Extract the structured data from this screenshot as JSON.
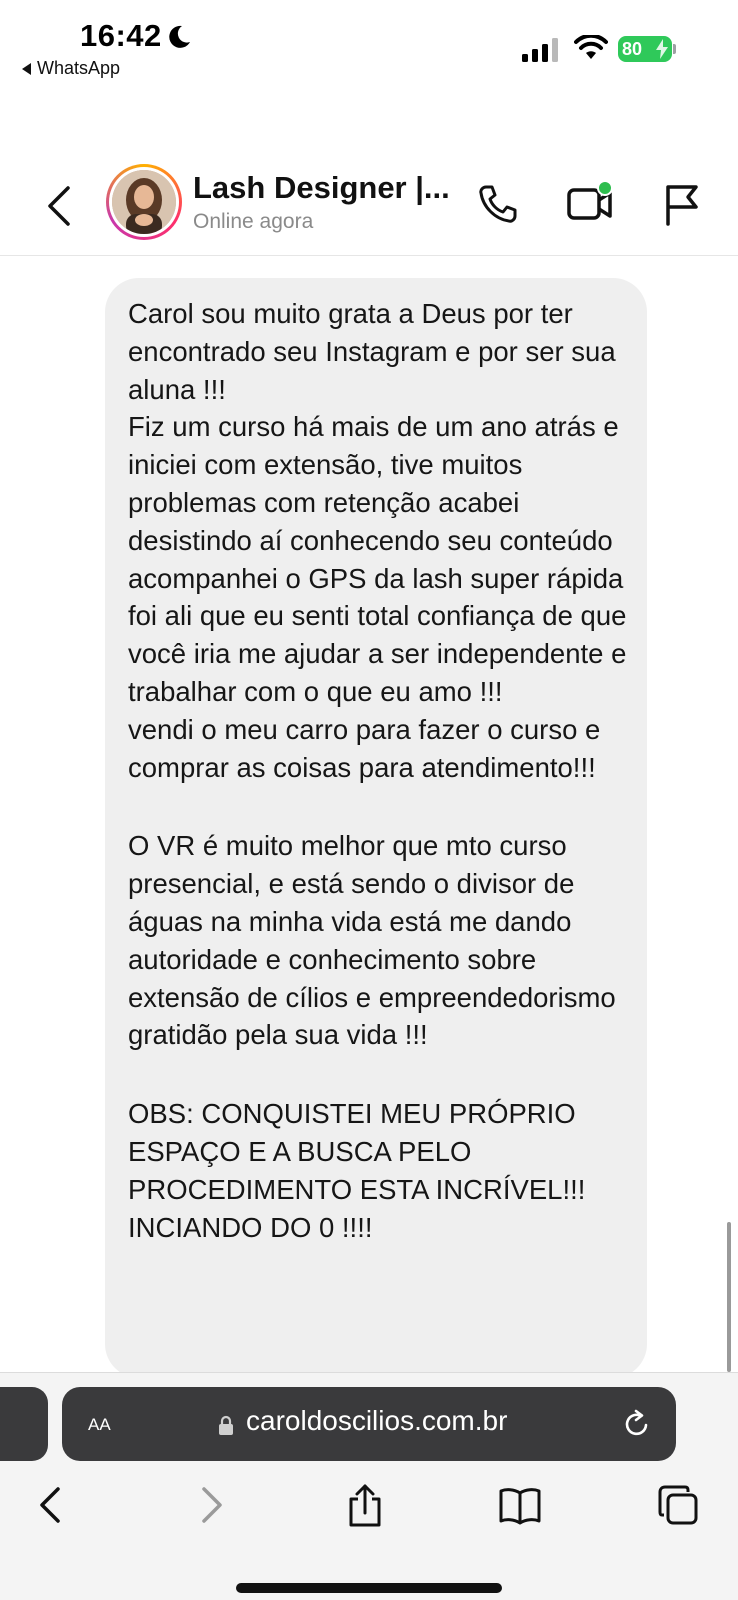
{
  "status_bar": {
    "time": "16:42",
    "back_app": "WhatsApp",
    "battery": "80"
  },
  "chat_header": {
    "contact_name": "Lash Designer |...",
    "status": "Online agora"
  },
  "message": {
    "paragraphs": [
      "Carol sou muito grata a Deus por ter encontrado seu Instagram e por ser sua aluna !!!",
      "Fiz um curso há mais de um ano atrás e iniciei com extensão, tive muitos problemas com retenção acabei desistindo aí conhecendo seu conteúdo acompanhei o GPS da lash super rápida foi ali que eu senti total confiança de que você iria me ajudar a ser independente e trabalhar com o que eu amo !!!",
      "vendi o meu carro para fazer o curso e comprar as coisas para atendimento!!!",
      "O VR é muito melhor que mto curso presencial, e está sendo o divisor de águas na minha vida está me dando autoridade e conhecimento sobre extensão de cílios e empreendedorismo gratidão pela sua vida !!!",
      "OBS: CONQUISTEI MEU PRÓPRIO ESPAÇO E A BUSCA PELO PROCEDIMENTO ESTA INCRÍVEL!!! INCIANDO DO 0 !!!!"
    ]
  },
  "browser": {
    "text_size_label": "AA",
    "url": "caroldoscilios.com.br"
  }
}
